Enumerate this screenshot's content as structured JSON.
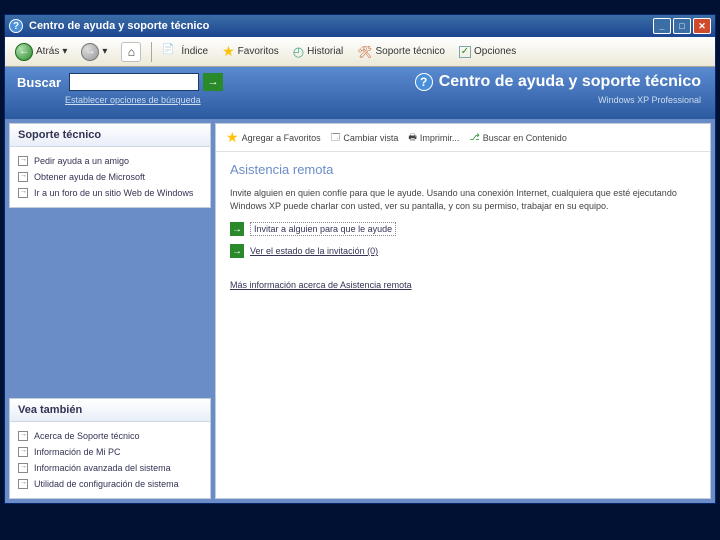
{
  "titlebar": {
    "title": "Centro de ayuda y soporte técnico"
  },
  "toolbar": {
    "back": "Atrás",
    "index": "Índice",
    "favorites": "Favoritos",
    "history": "Historial",
    "support": "Soporte técnico",
    "options": "Opciones"
  },
  "bluebar": {
    "search_label": "Buscar",
    "search_opts": "Establecer opciones de búsqueda",
    "big_title": "Centro de ayuda y soporte técnico",
    "edition": "Windows XP Professional"
  },
  "left": {
    "support": {
      "header": "Soporte técnico",
      "items": [
        "Pedir ayuda a un amigo",
        "Obtener ayuda de Microsoft",
        "Ir a un foro de un sitio Web de Windows"
      ]
    },
    "also": {
      "header": "Vea también",
      "items": [
        "Acerca de Soporte técnico",
        "Información de Mi PC",
        "Información avanzada del sistema",
        "Utilidad de configuración de sistema"
      ]
    }
  },
  "actions": {
    "addfav": "Agregar a Favoritos",
    "changeview": "Cambiar vista",
    "print": "Imprimir...",
    "locate": "Buscar en Contenido"
  },
  "content": {
    "heading": "Asistencia remota",
    "para": "Invite alguien en quien confíe para que le ayude. Usando una conexión Internet, cualquiera que esté ejecutando Windows XP puede charlar con usted, ver su pantalla, y con su permiso, trabajar en su equipo.",
    "invite": "Invitar a alguien para que le ayude",
    "status": "Ver el estado de la invitación (0)",
    "more": "Más información acerca de Asistencia remota"
  }
}
